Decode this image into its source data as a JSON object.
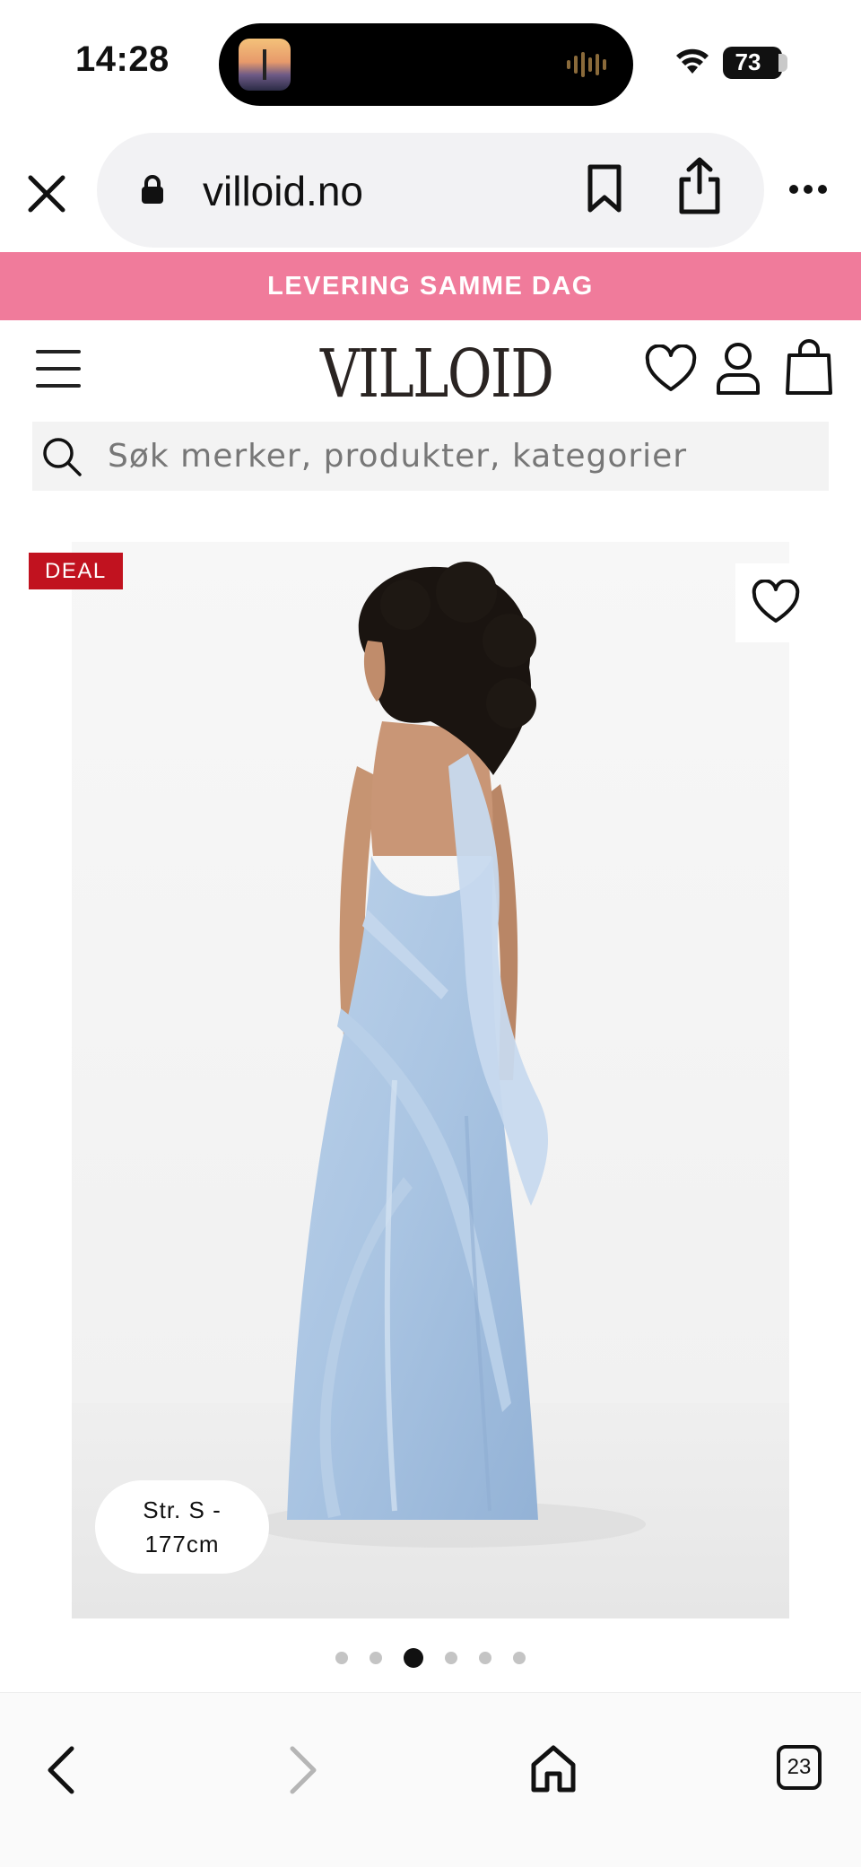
{
  "status_bar": {
    "time": "14:28",
    "battery": "73"
  },
  "browser": {
    "url": "villoid.no"
  },
  "promo": {
    "text": "LEVERING SAMME DAG"
  },
  "site": {
    "brand": "VILLOID"
  },
  "search": {
    "placeholder": "Søk merker, produkter, kategorier"
  },
  "product": {
    "badge": "DEAL",
    "size_line1": "Str. S -",
    "size_line2": "177cm",
    "image_count": 6,
    "active_image": 3
  },
  "toolbar": {
    "tab_count": "23"
  },
  "colors": {
    "promo_bg": "#f07b9b",
    "deal_badge": "#c1121f",
    "dress": "#a9c4e2"
  }
}
